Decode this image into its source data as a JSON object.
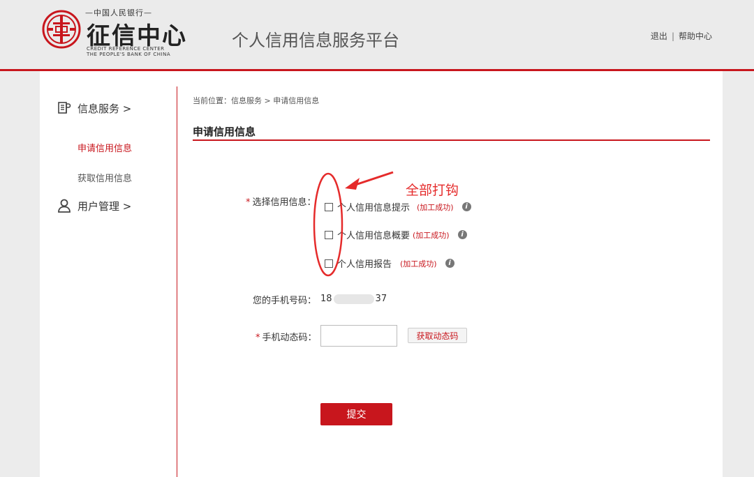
{
  "header": {
    "logo_top": "—中国人民银行—",
    "logo_main": "征信中心",
    "logo_en_line1": "CREDIT REFERENCE CENTER",
    "logo_en_line2": "THE PEOPLE'S BANK OF CHINA",
    "platform_title": "个人信用信息服务平台",
    "logout": "退出",
    "separator": "|",
    "help": "帮助中心"
  },
  "sidebar": {
    "info_service": "信息服务 >",
    "apply_credit": "申请信用信息",
    "get_credit": "获取信用信息",
    "user_manage": "用户管理 >"
  },
  "main": {
    "breadcrumb": "当前位置：信息服务 > 申请信用信息",
    "section_title": "申请信用信息",
    "select_label": "选择信用信息：",
    "req_mark": "*",
    "options": [
      {
        "label": "个人信用信息提示",
        "status": "(加工成功)"
      },
      {
        "label": "个人信用信息概要",
        "status": "(加工成功)"
      },
      {
        "label": "个人信用报告",
        "status": "(加工成功)"
      }
    ],
    "info_glyph": "i",
    "phone_label": "您的手机号码：",
    "phone_prefix": "18",
    "phone_suffix": "37",
    "code_label": "手机动态码：",
    "code_value": "",
    "get_code_btn": "获取动态码",
    "submit_btn": "提交"
  },
  "annotation": {
    "text": "全部打钩"
  },
  "colors": {
    "brand_red": "#c8161d",
    "annotation_red": "#e52b2b"
  }
}
